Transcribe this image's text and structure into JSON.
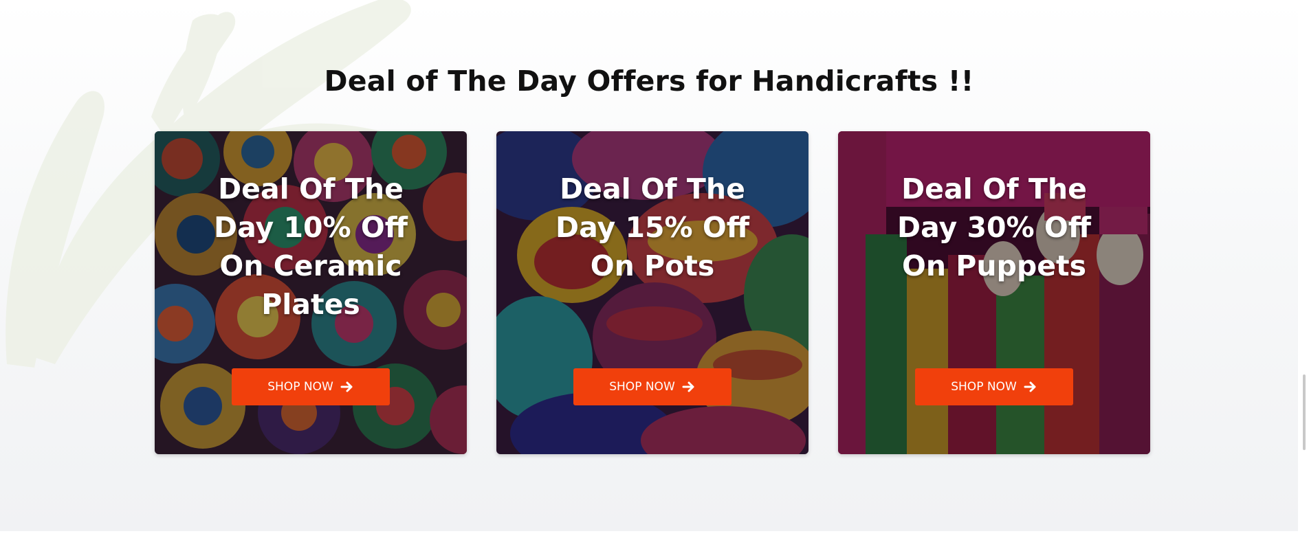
{
  "section": {
    "heading": "Deal of The Day Offers for Handicrafts !!"
  },
  "deals": [
    {
      "title": "Deal Of The Day 10% Off On Ceramic Plates",
      "button_label": "SHOP NOW",
      "button_icon": "arrow-right-icon",
      "image_theme": "painted ceramic plates"
    },
    {
      "title": "Deal Of The Day 15% Off On Pots",
      "button_label": "SHOP NOW",
      "button_icon": "arrow-right-icon",
      "image_theme": "colorful clay pots"
    },
    {
      "title": "Deal Of The Day 30% Off On Puppets",
      "button_label": "SHOP NOW",
      "button_icon": "arrow-right-icon",
      "image_theme": "rajasthani puppets"
    }
  ],
  "colors": {
    "button": "#f1400c",
    "heading": "#111111",
    "card_text": "#ffffff"
  }
}
